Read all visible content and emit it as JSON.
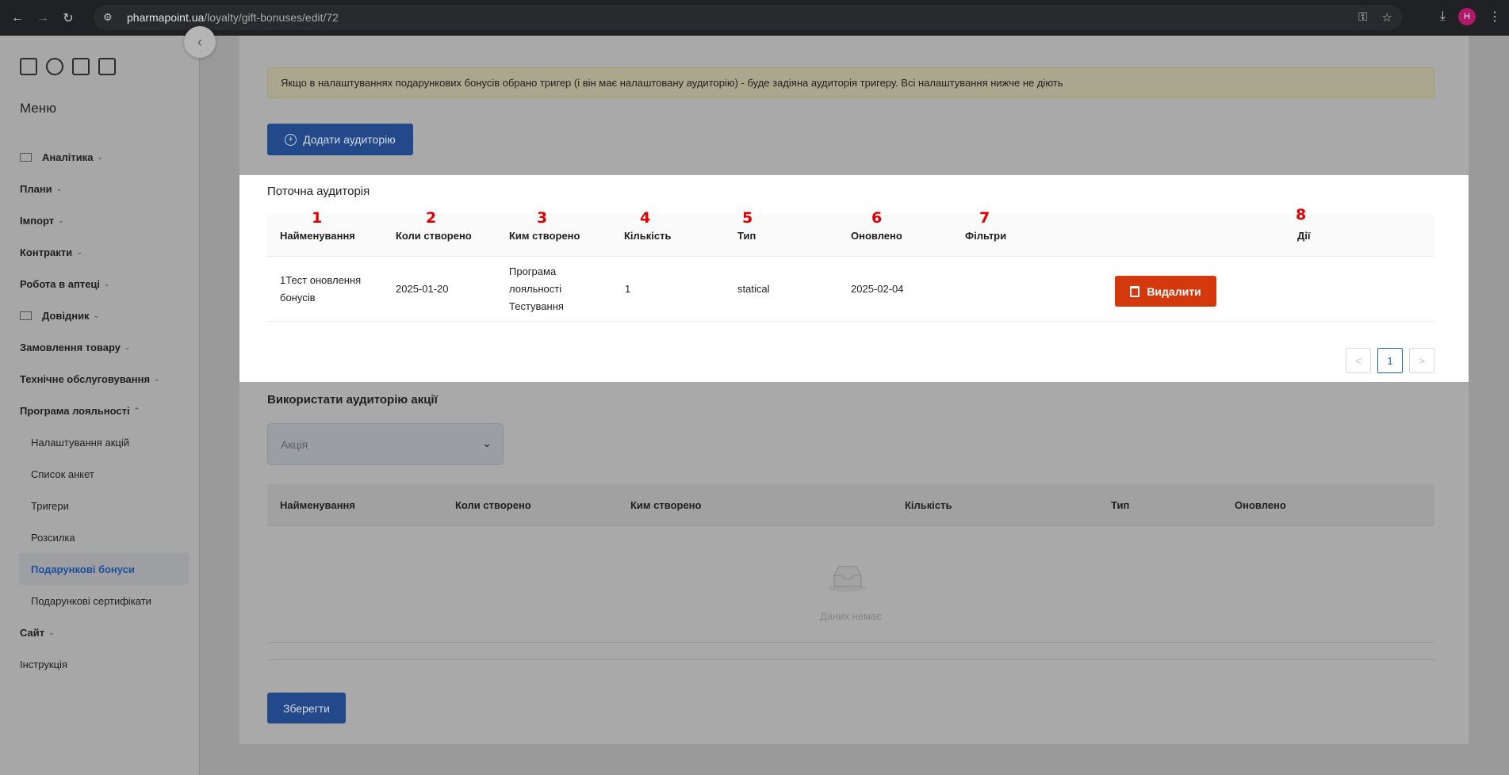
{
  "browser": {
    "url_host": "pharmapoint.ua",
    "url_path": "/loyalty/gift-bonuses/edit/72",
    "avatar_letter": "H"
  },
  "sidebar": {
    "menu_title": "Меню",
    "items": [
      {
        "label": "Аналітика",
        "has_icon": true,
        "chevron": "⌄"
      },
      {
        "label": "Плани",
        "chevron": "⌄"
      },
      {
        "label": "Імпорт",
        "chevron": "⌄"
      },
      {
        "label": "Контракти",
        "chevron": "⌄"
      },
      {
        "label": "Робота в аптеці",
        "chevron": "⌄"
      },
      {
        "label": "Довідник",
        "has_icon": true,
        "chevron": "⌄"
      },
      {
        "label": "Замовлення товару",
        "chevron": "⌄"
      },
      {
        "label": "Технічне обслуговування",
        "chevron": "⌄"
      },
      {
        "label": "Програма лояльності",
        "chevron": "⌃"
      }
    ],
    "subitems": [
      {
        "label": "Налаштування акцій"
      },
      {
        "label": "Список анкет"
      },
      {
        "label": "Тригери"
      },
      {
        "label": "Розсилка"
      },
      {
        "label": "Подарункові бонуси",
        "active": true
      },
      {
        "label": "Подарункові сертифікати"
      }
    ],
    "tail_items": [
      {
        "label": "Сайт",
        "chevron": "⌄"
      },
      {
        "label": "Інструкція"
      }
    ]
  },
  "main": {
    "alert_text": "Якщо в налаштуваннях подарункових бонусів обрано тригер (і він має налаштовану аудиторію) - буде задіяна аудиторія тригеру. Всі налаштування нижче не діють",
    "add_audience_label": "Додати аудиторію",
    "current_audience_title": "Поточна аудиторія",
    "table_columns": [
      {
        "num": "1",
        "label": "Найменування"
      },
      {
        "num": "2",
        "label": "Коли створено"
      },
      {
        "num": "3",
        "label": "Ким створено"
      },
      {
        "num": "4",
        "label": "Кількість"
      },
      {
        "num": "5",
        "label": "Тип"
      },
      {
        "num": "6",
        "label": "Оновлено"
      },
      {
        "num": "7",
        "label": "Фільтри"
      },
      {
        "num": "8",
        "label": "Дії"
      }
    ],
    "row": {
      "name_line1": "1Тест оновлення",
      "name_line2": "бонусів",
      "created": "2025-01-20",
      "creator_line1": "Програма",
      "creator_line2": "лояльності",
      "creator_line3": "Тестування",
      "count": "1",
      "type": "statical",
      "updated": "2025-02-04",
      "filters": "",
      "delete_label": "Видалити"
    },
    "pagination": {
      "prev": "<",
      "current": "1",
      "next": ">"
    },
    "use_promo_title": "Використати аудиторію акції",
    "promo_select_placeholder": "Акція",
    "table2_columns": [
      "Найменування",
      "Коли створено",
      "Ким створено",
      "Кількість",
      "Тип",
      "Оновлено"
    ],
    "empty_text": "Даних немає",
    "save_label": "Зберегти"
  }
}
